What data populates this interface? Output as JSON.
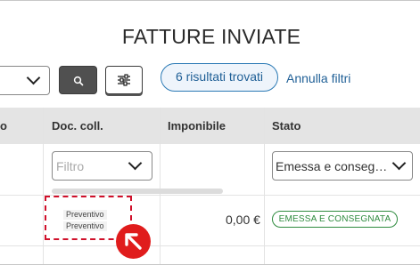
{
  "header": {
    "title": "FATTURE INVIATE"
  },
  "toolbar": {
    "search_icon": "search-icon",
    "filters_icon": "sliders-icon",
    "results_label": "6 risultati trovati",
    "reset_filters_label": "Annulla filtri"
  },
  "table": {
    "columns": [
      "o",
      "Doc. coll.",
      "Imponibile",
      "Stato"
    ],
    "filters": {
      "doc_coll_placeholder": "Filtro",
      "stato_value": "Emessa e conseg…"
    },
    "rows": [
      {
        "doc_coll": [
          "Preventivo",
          "Preventivo"
        ],
        "imponibile": "0,00 €",
        "stato": "EMESSA E CONSEGNATA"
      }
    ]
  },
  "colors": {
    "accent_blue": "#1f5f96",
    "status_green": "#2e8b3e",
    "highlight_red": "#d0102a",
    "header_gray": "#e4e4e4"
  },
  "annotation": {
    "pointer_icon": "arrow-up-left-icon"
  }
}
